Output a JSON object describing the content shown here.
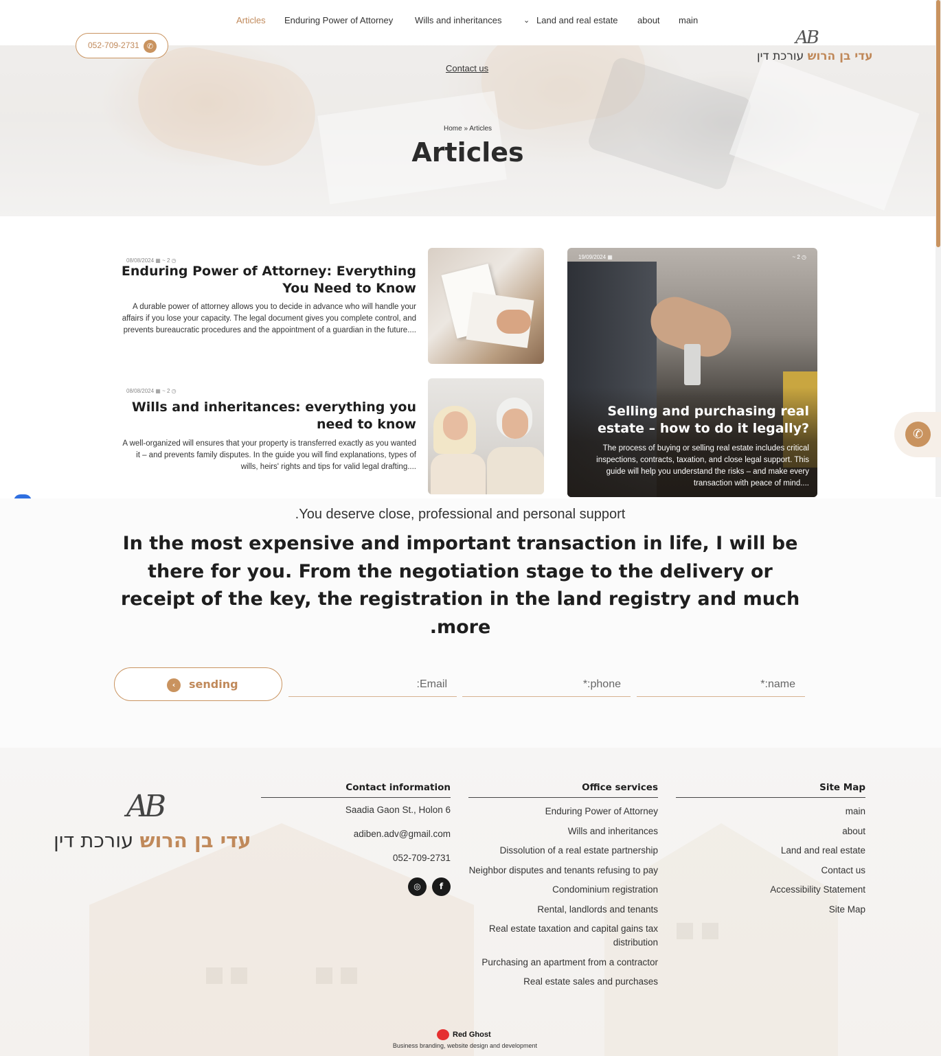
{
  "nav": {
    "items": [
      "Articles",
      "Enduring Power of Attorney",
      "Wills and inheritances",
      "Land and real estate",
      "about",
      "main"
    ],
    "contact": "Contact us",
    "phone": "052-709-2731"
  },
  "logo": {
    "brand": "עדי בן הרוש",
    "title": "עורכת דין",
    "monogram": "AB"
  },
  "hero": {
    "breadcrumb": "Home » Articles",
    "title": "Articles"
  },
  "articles": [
    {
      "date": "08/08/2024",
      "read_time": "~ 2",
      "title": "Enduring Power of Attorney: Everything You Need to Know",
      "excerpt": "A durable power of attorney allows you to decide in advance who will handle your affairs if you lose your capacity. The legal document gives you complete control, and prevents bureaucratic procedures and the appointment of a guardian in the future...."
    },
    {
      "date": "08/08/2024",
      "read_time": "~ 2",
      "title": "Wills and inheritances: everything you need to know",
      "excerpt": "A well-organized will ensures that your property is transferred exactly as you wanted it – and prevents family disputes. In the guide you will find explanations, types of wills, heirs' rights and tips for valid legal drafting...."
    }
  ],
  "featured": {
    "date": "19/09/2024",
    "read_time": "~ 2",
    "title": "Selling and purchasing real estate – how to do it legally?",
    "excerpt": "The process of buying or selling real estate includes critical inspections, contracts, taxation, and close legal support. This guide will help you understand the risks – and make every transaction with peace of mind...."
  },
  "cta": {
    "subtitle": "You deserve close, professional and personal support.",
    "headline": "In the most expensive and important transaction in life, I will be there for you. From the negotiation stage to the delivery or receipt of the key, the registration in the land registry and much more.",
    "send": "sending",
    "email_placeholder": "Email:",
    "phone_placeholder": "phone:*",
    "name_placeholder": "name:*"
  },
  "footer": {
    "contact_title": "Contact information",
    "contact": [
      "Saadia Gaon St., Holon 6",
      "adiben.adv@gmail.com",
      "052-709-2731"
    ],
    "services_title": "Office services",
    "services": [
      "Enduring Power of Attorney",
      "Wills and inheritances",
      "Dissolution of a real estate partnership",
      "Neighbor disputes and tenants refusing to pay",
      "Condominium registration",
      "Rental, landlords and tenants",
      "Real estate taxation and capital gains tax distribution",
      "Purchasing an apartment from a contractor",
      "Real estate sales and purchases"
    ],
    "sitemap_title": "Site Map",
    "sitemap": [
      "main",
      "about",
      "Land and real estate",
      "Contact us",
      "Accessibility Statement",
      "Site Map"
    ],
    "social": [
      "instagram-icon",
      "facebook-icon"
    ]
  },
  "credit": {
    "name": "Red Ghost",
    "tagline": "Business branding, website design and development"
  },
  "colors": {
    "accent": "#c9935f",
    "accent_text": "#c0895a",
    "text": "#1e1e1e"
  }
}
